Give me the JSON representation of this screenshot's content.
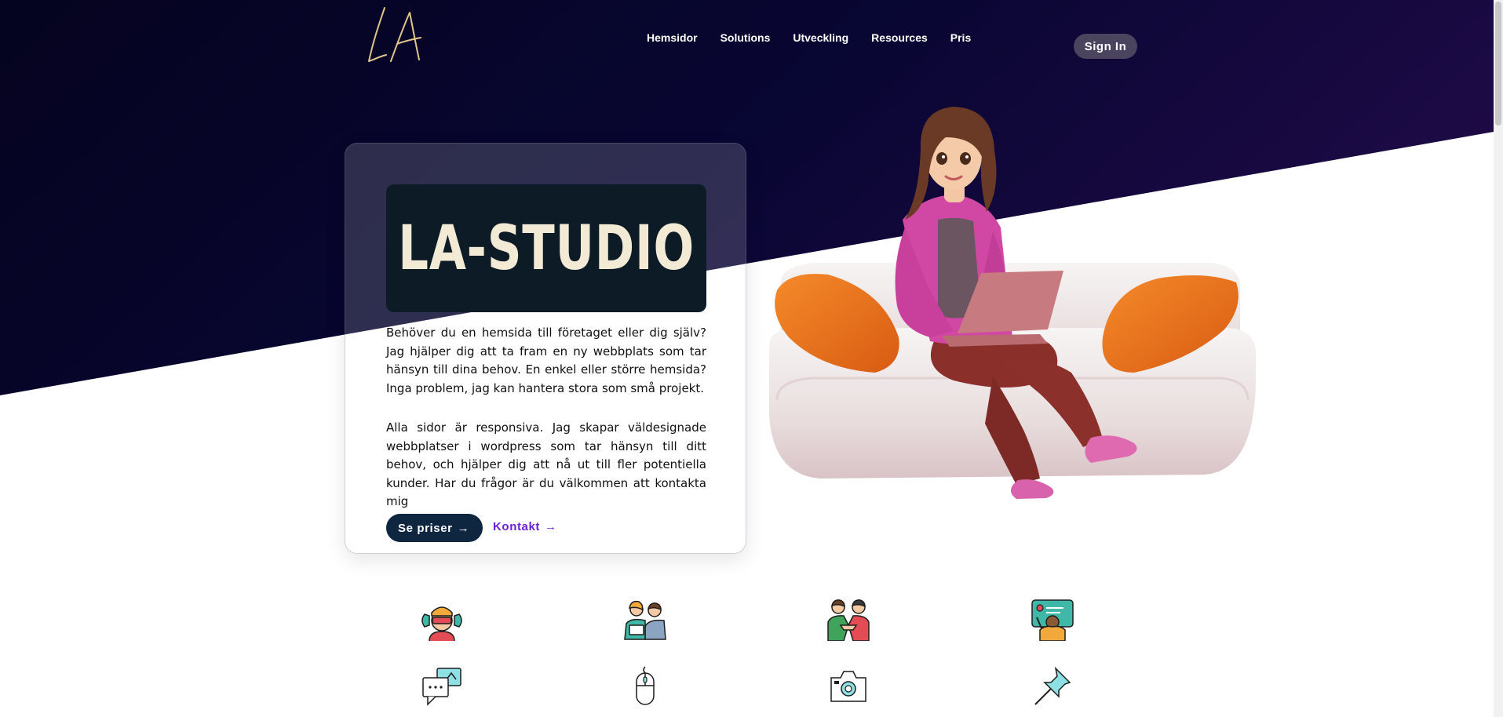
{
  "header": {
    "logo_text": "LA",
    "nav": [
      {
        "label": "Hemsidor"
      },
      {
        "label": "Solutions"
      },
      {
        "label": "Utveckling"
      },
      {
        "label": "Resources"
      },
      {
        "label": "Pris"
      }
    ],
    "sign_in_label": "Sign In"
  },
  "hero": {
    "banner_text": "LA-STUDIO",
    "paragraph_1": "Behöver du en hemsida till företaget eller dig själv? Jag hjälper dig att ta fram en ny webbplats som tar hänsyn till dina behov. En enkel eller större hemsida? Inga problem, jag kan hantera stora som små projekt.",
    "paragraph_2": "Alla sidor är responsiva. Jag skapar väldesignade webbplatser i wordpress som tar hänsyn till ditt behov, och hjälper dig att nå ut till fler potentiella kunder. Har du frågor är du välkommen att kontakta mig",
    "primary_button_label": "Se priser",
    "secondary_link_label": "Kontakt",
    "arrow": "→"
  },
  "features": {
    "icons": [
      "vr-headset-person-icon",
      "online-meeting-icon",
      "handshake-icon",
      "presenter-board-icon",
      "chat-bubbles-icon",
      "computer-mouse-icon",
      "camera-icon",
      "push-pin-icon"
    ]
  },
  "colors": {
    "hero_dark": "#07062a",
    "accent_purple": "#6a22d6",
    "primary_button": "#0f2640",
    "sign_in_bg": "#4a445e",
    "banner_bg": "#0c1b26"
  }
}
